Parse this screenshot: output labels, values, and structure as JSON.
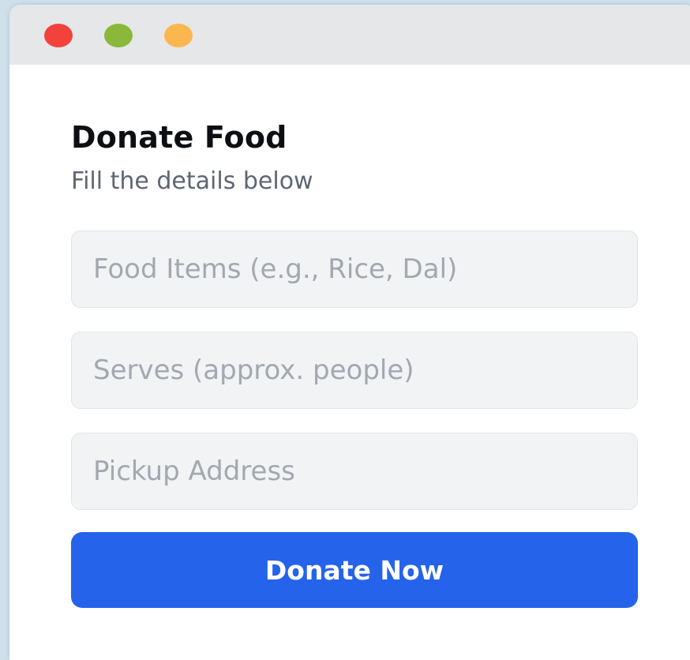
{
  "window": {
    "controls": [
      {
        "name": "close",
        "color": "#f2423b"
      },
      {
        "name": "minimize",
        "color": "#8ab83a"
      },
      {
        "name": "maximize",
        "color": "#fbb74f"
      }
    ]
  },
  "form": {
    "title": "Donate Food",
    "subtitle": "Fill the details below",
    "fields": [
      {
        "placeholder": "Food Items (e.g., Rice, Dal)",
        "value": ""
      },
      {
        "placeholder": "Serves (approx. people)",
        "value": ""
      },
      {
        "placeholder": "Pickup Address",
        "value": ""
      }
    ],
    "submit_label": "Donate Now"
  },
  "colors": {
    "accent": "#2563eb",
    "field_background": "#f2f3f5",
    "titlebar": "#e6e7e9"
  }
}
